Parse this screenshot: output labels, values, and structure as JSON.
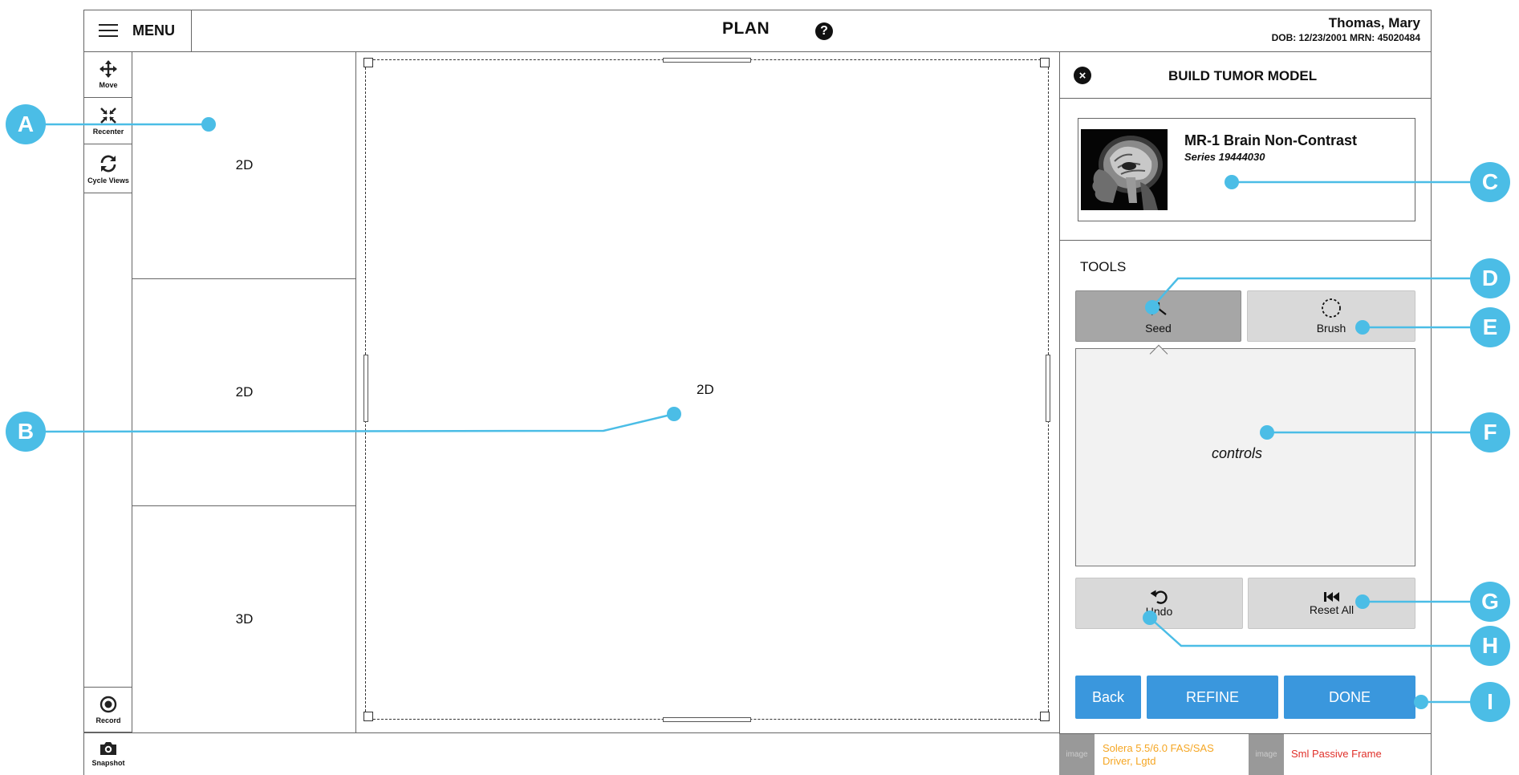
{
  "header": {
    "menu_label": "MENU",
    "title": "PLAN",
    "help_icon": "?",
    "patient_name": "Thomas, Mary",
    "patient_meta": "DOB: 12/23/2001   MRN: 45020484"
  },
  "toolbar": {
    "move": "Move",
    "recenter": "Recenter",
    "cycle_views": "Cycle Views",
    "record": "Record",
    "snapshot": "Snapshot"
  },
  "views": {
    "thumb1": "2D",
    "thumb2": "2D",
    "thumb3": "3D",
    "main": "2D"
  },
  "panel": {
    "close_icon": "×",
    "title": "BUILD TUMOR MODEL",
    "series_name": "MR-1 Brain Non-Contrast",
    "series_number": "Series 19444030",
    "tools_label": "TOOLS",
    "seed_label": "Seed",
    "brush_label": "Brush",
    "controls_label": "controls",
    "undo_label": "Undo",
    "reset_label": "Reset All",
    "back_label": "Back",
    "refine_label": "REFINE",
    "done_label": "DONE"
  },
  "status": {
    "image_placeholder_1": "image",
    "driver_text_line1": "Solera 5.5/6.0 FAS/SAS",
    "driver_text_line2": "Driver, Lgtd",
    "image_placeholder_2": "image",
    "frame_text": "Sml Passive Frame",
    "driver_color": "#f5a623",
    "frame_color": "#e0302a"
  },
  "callouts": [
    "A",
    "B",
    "C",
    "D",
    "E",
    "F",
    "G",
    "H",
    "I"
  ],
  "colors": {
    "accent": "#3a97dd",
    "callout": "#4bbde6"
  }
}
